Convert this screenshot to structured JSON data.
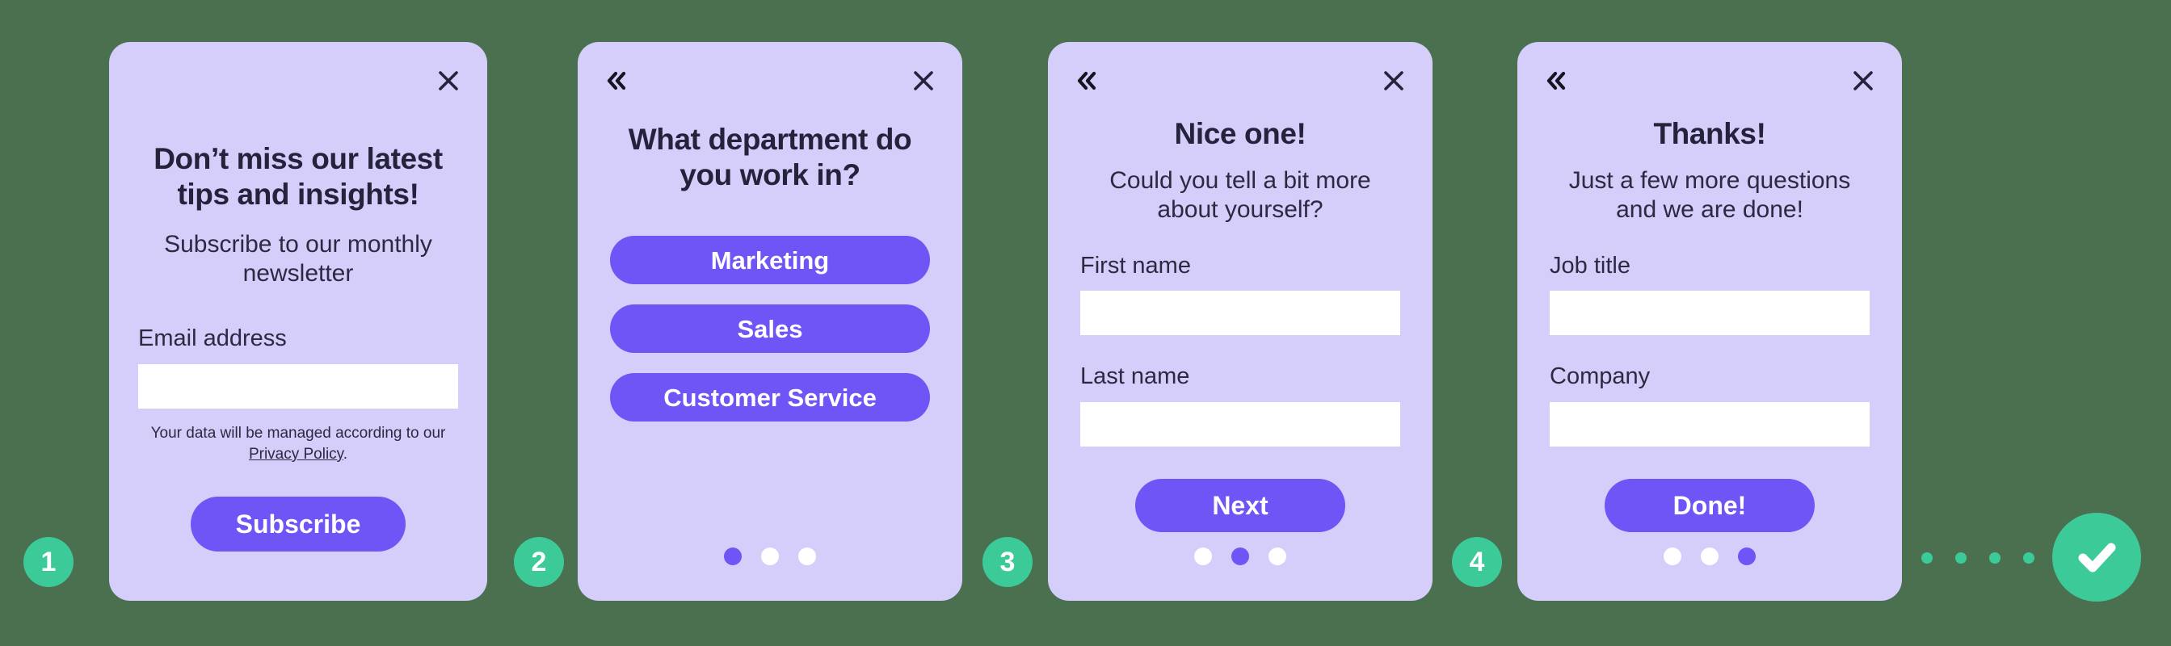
{
  "theme": {
    "page_background": "#4a7050",
    "card_background": "#d5cdfa",
    "accent_purple": "#6f55f5",
    "accent_green": "#3ccb98",
    "text_dark": "#25233c",
    "field_background": "#ffffff"
  },
  "icons": {
    "close": "close-icon",
    "back": "double-chevron-left-icon",
    "check": "check-icon"
  },
  "steps": [
    {
      "badge": "1"
    },
    {
      "badge": "2"
    },
    {
      "badge": "3"
    },
    {
      "badge": "4"
    }
  ],
  "cards": [
    {
      "id": "newsletter-signup",
      "has_back": false,
      "has_close": true,
      "title": "Don’t miss our latest tips and insights!",
      "subtitle": "Subscribe to our monthly newsletter",
      "fields": [
        {
          "label": "Email address",
          "value": "",
          "placeholder": ""
        }
      ],
      "fine_print_prefix": "Your data will be managed according to our ",
      "fine_print_link": "Privacy Policy",
      "fine_print_suffix": ".",
      "submit_label": "Subscribe",
      "dots": null
    },
    {
      "id": "department-question",
      "has_back": true,
      "has_close": true,
      "title": "What department do you work in?",
      "options": [
        "Marketing",
        "Sales",
        "Customer Service"
      ],
      "dots": {
        "count": 3,
        "active": 0
      }
    },
    {
      "id": "name-question",
      "has_back": true,
      "has_close": true,
      "title": "Nice one!",
      "subtitle": "Could you tell a bit more about yourself?",
      "fields": [
        {
          "label": "First name",
          "value": "",
          "placeholder": ""
        },
        {
          "label": "Last name",
          "value": "",
          "placeholder": ""
        }
      ],
      "submit_label": "Next",
      "dots": {
        "count": 3,
        "active": 1
      }
    },
    {
      "id": "job-question",
      "has_back": true,
      "has_close": true,
      "title": "Thanks!",
      "subtitle": "Just a few more questions and we are done!",
      "fields": [
        {
          "label": "Job title",
          "value": "",
          "placeholder": ""
        },
        {
          "label": "Company",
          "value": "",
          "placeholder": ""
        }
      ],
      "submit_label": "Done!",
      "dots": {
        "count": 3,
        "active": 2
      }
    }
  ],
  "trail": {
    "dot_count": 4
  }
}
